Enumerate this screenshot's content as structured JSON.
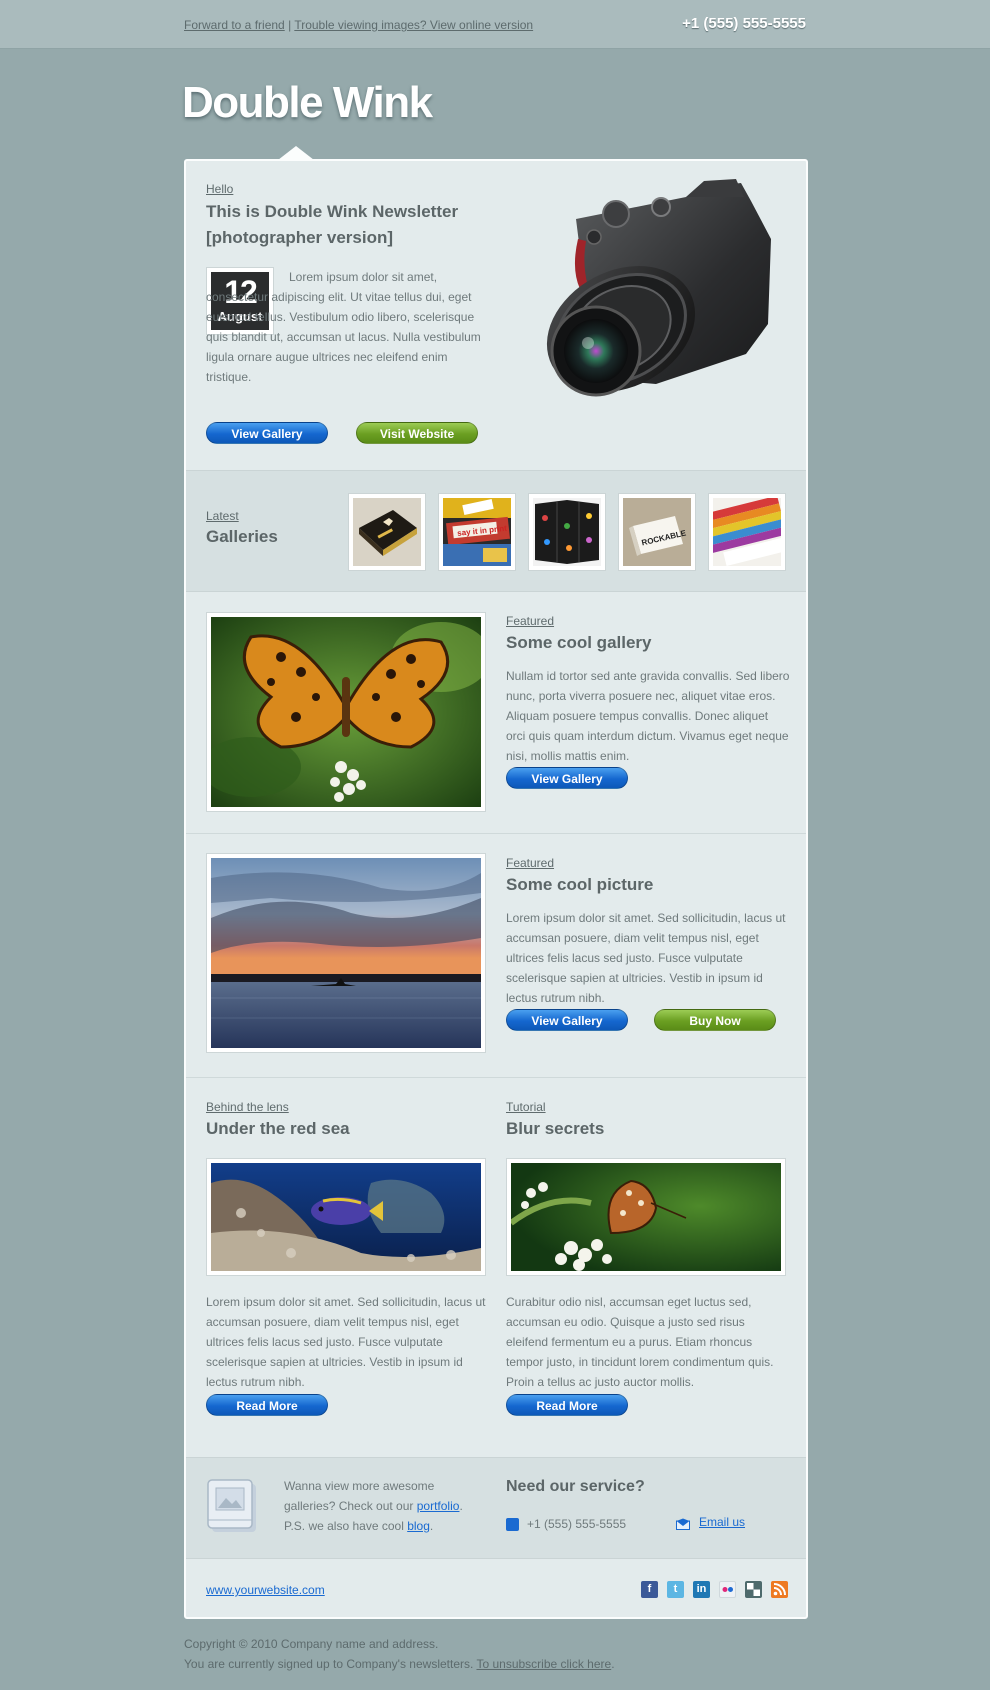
{
  "topbar": {
    "forward_link": "Forward to a friend",
    "separator": "|",
    "online_link": "Trouble viewing images? View online version",
    "phone": "+1 (555) 555-5555"
  },
  "brand": {
    "logo": "Double Wink"
  },
  "hero": {
    "eyebrow": "Hello",
    "title_line1": "This is Double Wink Newsletter",
    "title_line2": "[photographer version]",
    "date_day": "12",
    "date_month": "August",
    "body": "Lorem ipsum dolor sit amet, consectetur adipiscing elit. Ut vitae tellus dui, eget euismod tellus. Vestibulum odio libero, scelerisque quis blandit ut, accumsan ut lacus. Nulla vestibulum ligula ornare augue ultrices nec eleifend enim tristique.",
    "btn_gallery": "View Gallery",
    "btn_website": "Visit Website",
    "image_icon": "camera-icon"
  },
  "galleries": {
    "eyebrow": "Latest",
    "title": "Galleries"
  },
  "featured1": {
    "eyebrow": "Featured",
    "title": "Some cool gallery",
    "body": "Nullam id tortor sed ante gravida convallis. Sed libero nunc, porta viverra posuere nec, aliquet vitae eros. Aliquam posuere tempus convallis. Donec aliquet orci quis quam interdum dictum. Vivamus eget neque nisi, mollis mattis enim.",
    "btn": "View Gallery"
  },
  "featured2": {
    "eyebrow": "Featured",
    "title": "Some cool picture",
    "body": "Lorem ipsum dolor sit amet. Sed sollicitudin, lacus ut accumsan posuere, diam velit tempus nisl, eget ultrices felis lacus sed justo. Fusce vulputate scelerisque sapien at ultricies. Vestib in ipsum id lectus rutrum nibh.",
    "btn_gallery": "View Gallery",
    "btn_buy": "Buy Now"
  },
  "col_left": {
    "eyebrow": "Behind the lens",
    "title": "Under the red sea",
    "body": "Lorem ipsum dolor sit amet. Sed sollicitudin, lacus ut accumsan posuere, diam velit tempus nisl, eget ultrices felis lacus sed justo. Fusce vulputate scelerisque sapien at ultricies. Vestib in ipsum id lectus rutrum nibh.",
    "btn": "Read More"
  },
  "col_right": {
    "eyebrow": "Tutorial",
    "title": "Blur secrets",
    "body": "Curabitur odio nisl, accumsan eget luctus sed, accumsan eu odio. Quisque a justo sed risus eleifend fermentum eu a purus. Etiam rhoncus tempor justo, in tincidunt lorem condimentum quis. Proin a tellus ac justo auctor mollis.",
    "btn": "Read More"
  },
  "more": {
    "text1": "Wanna view more awesome galleries? Check out our ",
    "portfolio_link": "portfolio",
    "text2": ". P.S. we also have cool ",
    "blog_link": "blog",
    "text3": ".",
    "service_title": "Need our service?",
    "phone": "+1 (555) 555-5555",
    "email_link": "Email us"
  },
  "footer": {
    "website": "www.yourwebsite.com",
    "social": [
      "facebook-icon",
      "twitter-icon",
      "linkedin-icon",
      "flickr-icon",
      "delicious-icon",
      "rss-icon"
    ]
  },
  "bottom": {
    "copyright": "Copyright © 2010 Company name and address.",
    "signed_text": "You are currently signed up to Company's newsletters.",
    "unsubscribe": "To unsubscribe click here",
    "period": "."
  },
  "colors": {
    "background": "#95a9ab",
    "card": "#e3ebec",
    "accent_blue": "#1567cf",
    "accent_green": "#6b9f22",
    "link_blue": "#1a6ad1"
  }
}
